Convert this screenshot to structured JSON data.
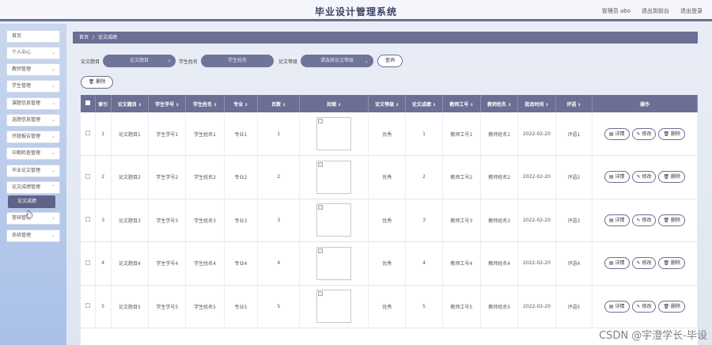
{
  "header": {
    "title": "毕业设计管理系统",
    "user": "管理员 abo",
    "front_link": "退出到前台",
    "logout": "退出登录"
  },
  "sidebar": {
    "items": [
      {
        "label": "首页",
        "chevron": false
      },
      {
        "label": "个人中心",
        "chevron": true
      },
      {
        "label": "教师管理",
        "chevron": true
      },
      {
        "label": "学生管理",
        "chevron": true
      },
      {
        "label": "课题信息管理",
        "chevron": true
      },
      {
        "label": "选题信息管理",
        "chevron": true
      },
      {
        "label": "开题报告管理",
        "chevron": true
      },
      {
        "label": "中期检查管理",
        "chevron": true
      },
      {
        "label": "毕业论文管理",
        "chevron": true
      },
      {
        "label": "论文成绩管理",
        "chevron": true
      },
      {
        "label": "答辩管理",
        "chevron": true
      },
      {
        "label": "系统管理",
        "chevron": true
      }
    ],
    "active_sub": "论文成绩"
  },
  "breadcrumb": {
    "home": "首页",
    "sep": "/",
    "current": "论文成绩"
  },
  "search": {
    "title_label": "论文题目",
    "title_placeholder": "论文题目",
    "name_label": "学生姓名",
    "name_placeholder": "学生姓名",
    "grade_label": "论文等级",
    "grade_placeholder": "请选择论文等级",
    "query_button": "查询"
  },
  "actions": {
    "delete": "删除"
  },
  "table": {
    "headers": {
      "index": "索引",
      "title": "论文题目",
      "student_no": "学生学号",
      "student_name": "学生姓名",
      "major": "专业",
      "pages": "页数",
      "cover": "封面",
      "grade": "论文等级",
      "score": "论文成绩",
      "teacher_no": "教师工号",
      "teacher_name": "教师姓名",
      "date": "批改时间",
      "comment": "评语",
      "ops": "操作"
    },
    "op_labels": {
      "detail": "详情",
      "edit": "修改",
      "delete": "删除"
    },
    "rows": [
      {
        "index": "1",
        "title": "论文题目1",
        "student_no": "学生学号1",
        "student_name": "学生姓名1",
        "major": "专业1",
        "pages": "1",
        "grade": "优秀",
        "score": "1",
        "teacher_no": "教师工号1",
        "teacher_name": "教师姓名1",
        "date": "2022-02-20",
        "comment": "评语1"
      },
      {
        "index": "2",
        "title": "论文题目2",
        "student_no": "学生学号2",
        "student_name": "学生姓名2",
        "major": "专业2",
        "pages": "2",
        "grade": "优秀",
        "score": "2",
        "teacher_no": "教师工号2",
        "teacher_name": "教师姓名2",
        "date": "2022-02-20",
        "comment": "评语2"
      },
      {
        "index": "3",
        "title": "论文题目3",
        "student_no": "学生学号3",
        "student_name": "学生姓名3",
        "major": "专业3",
        "pages": "3",
        "grade": "优秀",
        "score": "3",
        "teacher_no": "教师工号3",
        "teacher_name": "教师姓名3",
        "date": "2022-02-20",
        "comment": "评语3"
      },
      {
        "index": "4",
        "title": "论文题目4",
        "student_no": "学生学号4",
        "student_name": "学生姓名4",
        "major": "专业4",
        "pages": "4",
        "grade": "优秀",
        "score": "4",
        "teacher_no": "教师工号4",
        "teacher_name": "教师姓名4",
        "date": "2022-02-20",
        "comment": "评语4"
      },
      {
        "index": "5",
        "title": "论文题目5",
        "student_no": "学生学号5",
        "student_name": "学生姓名5",
        "major": "专业5",
        "pages": "5",
        "grade": "优秀",
        "score": "5",
        "teacher_no": "教师工号5",
        "teacher_name": "教师姓名5",
        "date": "2022-02-20",
        "comment": "评语5"
      }
    ]
  },
  "watermark": "CSDN @宇澄学长-毕设"
}
